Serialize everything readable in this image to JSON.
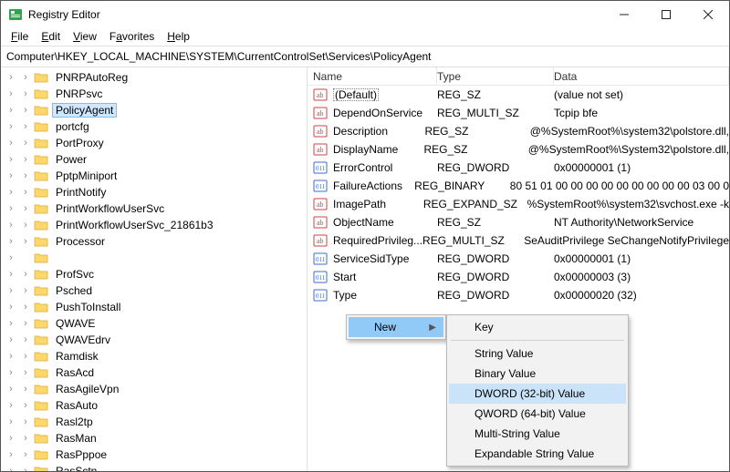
{
  "window": {
    "title": "Registry Editor"
  },
  "menu": {
    "file": "File",
    "edit": "Edit",
    "view": "View",
    "favorites": "Favorites",
    "help": "Help"
  },
  "address": "Computer\\HKEY_LOCAL_MACHINE\\SYSTEM\\CurrentControlSet\\Services\\PolicyAgent",
  "tree": [
    {
      "label": "PNRPAutoReg",
      "selected": false
    },
    {
      "label": "PNRPsvc",
      "selected": false
    },
    {
      "label": "PolicyAgent",
      "selected": true
    },
    {
      "label": "portcfg",
      "selected": false
    },
    {
      "label": "PortProxy",
      "selected": false
    },
    {
      "label": "Power",
      "selected": false
    },
    {
      "label": "PptpMiniport",
      "selected": false
    },
    {
      "label": "PrintNotify",
      "selected": false
    },
    {
      "label": "PrintWorkflowUserSvc",
      "selected": false
    },
    {
      "label": "PrintWorkflowUserSvc_21861b3",
      "selected": false
    },
    {
      "label": "Processor",
      "selected": false
    },
    {
      "label": "",
      "selected": false,
      "blank": true
    },
    {
      "label": "ProfSvc",
      "selected": false
    },
    {
      "label": "Psched",
      "selected": false
    },
    {
      "label": "PushToInstall",
      "selected": false
    },
    {
      "label": "QWAVE",
      "selected": false
    },
    {
      "label": "QWAVEdrv",
      "selected": false
    },
    {
      "label": "Ramdisk",
      "selected": false
    },
    {
      "label": "RasAcd",
      "selected": false
    },
    {
      "label": "RasAgileVpn",
      "selected": false
    },
    {
      "label": "RasAuto",
      "selected": false
    },
    {
      "label": "Rasl2tp",
      "selected": false
    },
    {
      "label": "RasMan",
      "selected": false
    },
    {
      "label": "RasPppoe",
      "selected": false
    },
    {
      "label": "RasSctn",
      "selected": false,
      "partial": true
    }
  ],
  "columns": {
    "name": "Name",
    "type": "Type",
    "data": "Data"
  },
  "values": [
    {
      "icon": "str",
      "name": "(Default)",
      "type": "REG_SZ",
      "data": "(value not set)",
      "focused": true
    },
    {
      "icon": "str",
      "name": "DependOnService",
      "type": "REG_MULTI_SZ",
      "data": "Tcpip bfe"
    },
    {
      "icon": "str",
      "name": "Description",
      "type": "REG_SZ",
      "data": "@%SystemRoot%\\system32\\polstore.dll,"
    },
    {
      "icon": "str",
      "name": "DisplayName",
      "type": "REG_SZ",
      "data": "@%SystemRoot%\\System32\\polstore.dll,"
    },
    {
      "icon": "bin",
      "name": "ErrorControl",
      "type": "REG_DWORD",
      "data": "0x00000001 (1)"
    },
    {
      "icon": "bin",
      "name": "FailureActions",
      "type": "REG_BINARY",
      "data": "80 51 01 00 00 00 00 00 00 00 00 00 03 00 0"
    },
    {
      "icon": "str",
      "name": "ImagePath",
      "type": "REG_EXPAND_SZ",
      "data": "%SystemRoot%\\system32\\svchost.exe -k"
    },
    {
      "icon": "str",
      "name": "ObjectName",
      "type": "REG_SZ",
      "data": "NT Authority\\NetworkService"
    },
    {
      "icon": "str",
      "name": "RequiredPrivileg...",
      "type": "REG_MULTI_SZ",
      "data": "SeAuditPrivilege SeChangeNotifyPrivilege"
    },
    {
      "icon": "bin",
      "name": "ServiceSidType",
      "type": "REG_DWORD",
      "data": "0x00000001 (1)"
    },
    {
      "icon": "bin",
      "name": "Start",
      "type": "REG_DWORD",
      "data": "0x00000003 (3)"
    },
    {
      "icon": "bin",
      "name": "Type",
      "type": "REG_DWORD",
      "data": "0x00000020 (32)"
    }
  ],
  "context_menu": {
    "parent": {
      "label": "New"
    },
    "items": [
      {
        "label": "Key",
        "type": "item"
      },
      {
        "type": "sep"
      },
      {
        "label": "String Value",
        "type": "item"
      },
      {
        "label": "Binary Value",
        "type": "item"
      },
      {
        "label": "DWORD (32-bit) Value",
        "type": "item",
        "highlight": true
      },
      {
        "label": "QWORD (64-bit) Value",
        "type": "item"
      },
      {
        "label": "Multi-String Value",
        "type": "item"
      },
      {
        "label": "Expandable String Value",
        "type": "item"
      }
    ]
  }
}
